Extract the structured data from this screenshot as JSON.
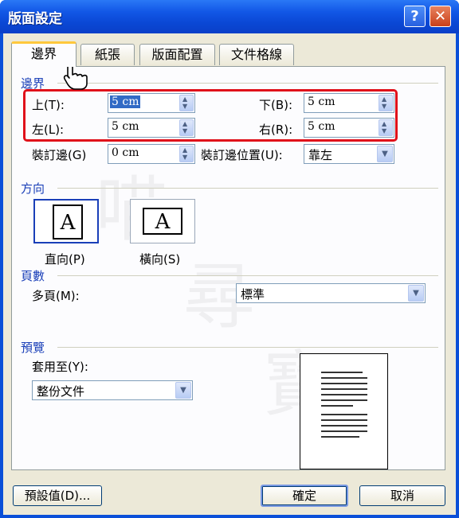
{
  "window": {
    "title": "版面設定",
    "help_label": "?",
    "close_label": "✕"
  },
  "tabs": [
    "邊界",
    "紙張",
    "版面配置",
    "文件格線"
  ],
  "margins": {
    "section": "邊界",
    "top_label": "上(T):",
    "top_value": "5 cm",
    "bottom_label": "下(B):",
    "bottom_value": "5 cm",
    "left_label": "左(L):",
    "left_value": "5 cm",
    "right_label": "右(R):",
    "right_value": "5 cm",
    "gutter_label": "裝訂邊(G)",
    "gutter_value": "0 cm",
    "gutter_pos_label": "裝訂邊位置(U):",
    "gutter_pos_value": "靠左"
  },
  "orientation": {
    "section": "方向",
    "portrait_label": "直向(P)",
    "landscape_label": "橫向(S)",
    "icon_glyph": "A",
    "selected": "portrait"
  },
  "pages": {
    "section": "頁數",
    "multiple_label": "多頁(M):",
    "multiple_value": "標準"
  },
  "preview": {
    "section": "預覽",
    "apply_label": "套用至(Y):",
    "apply_value": "整份文件"
  },
  "buttons": {
    "default": "預設值(D)...",
    "ok": "確定",
    "cancel": "取消"
  },
  "icons": {
    "help": "help-icon",
    "close": "close-icon",
    "spin": "spin-arrows-icon",
    "dropdown": "chevron-down-icon",
    "cursor": "hand-cursor-icon"
  },
  "colors": {
    "title_bar": "#0a4fd8",
    "highlight": "#e0101a",
    "section_text": "#1a3fb8",
    "tab_accent": "#ffc83c"
  }
}
